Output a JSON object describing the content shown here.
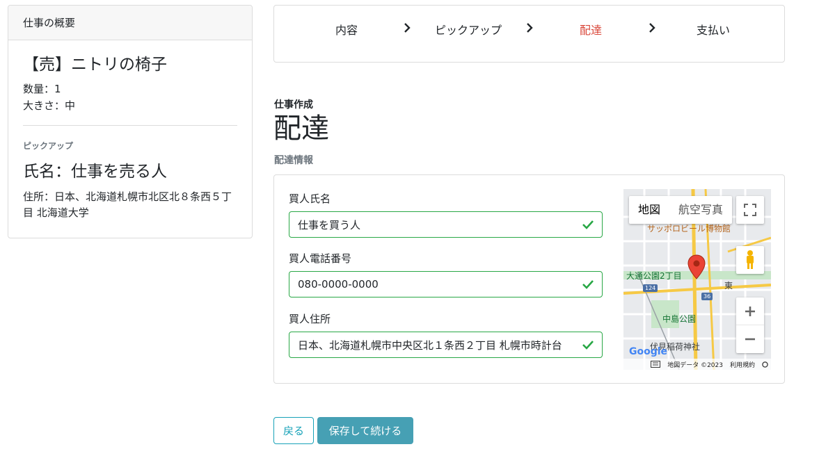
{
  "summary": {
    "header": "仕事の概要",
    "item_title": "【売】ニトリの椅子",
    "quantity": "数量：1",
    "size": "大きさ：中",
    "pickup_heading": "ピックアップ",
    "pickup_name": "氏名：仕事を売る人",
    "pickup_address": "住所：日本、北海道札幌市北区北８条西５丁目 北海道大学"
  },
  "steps": [
    {
      "label": "内容",
      "active": false
    },
    {
      "label": "ピックアップ",
      "active": false
    },
    {
      "label": "配達",
      "active": true
    },
    {
      "label": "支払い",
      "active": false
    }
  ],
  "heading": {
    "small": "仕事作成",
    "big": "配達",
    "info": "配達情報"
  },
  "form": {
    "buyer_name_label": "買人氏名",
    "buyer_name_value": "仕事を買う人",
    "buyer_phone_label": "買人電話番号",
    "buyer_phone_value": "080-0000-0000",
    "buyer_address_label": "買人住所",
    "buyer_address_value": "日本、北海道札幌市中央区北１条西２丁目 札幌市時計台"
  },
  "map": {
    "type_map": "地図",
    "type_satellite": "航空写真",
    "label_museum": "サッポロビール博物館",
    "label_park": "大通公園2丁目",
    "label_nakajima": "中島公園",
    "label_fushimi": "伏見稲荷神社",
    "label_higashi": "東",
    "road_124": "124",
    "road_36": "36",
    "google": "Google",
    "map_data": "地図データ ©2023",
    "terms": "利用規約"
  },
  "buttons": {
    "back": "戻る",
    "save": "保存して続ける"
  },
  "colors": {
    "active_step": "#d9473a",
    "valid": "#28a745",
    "accent": "#17a2b8",
    "save_bg": "#46a0b4"
  }
}
